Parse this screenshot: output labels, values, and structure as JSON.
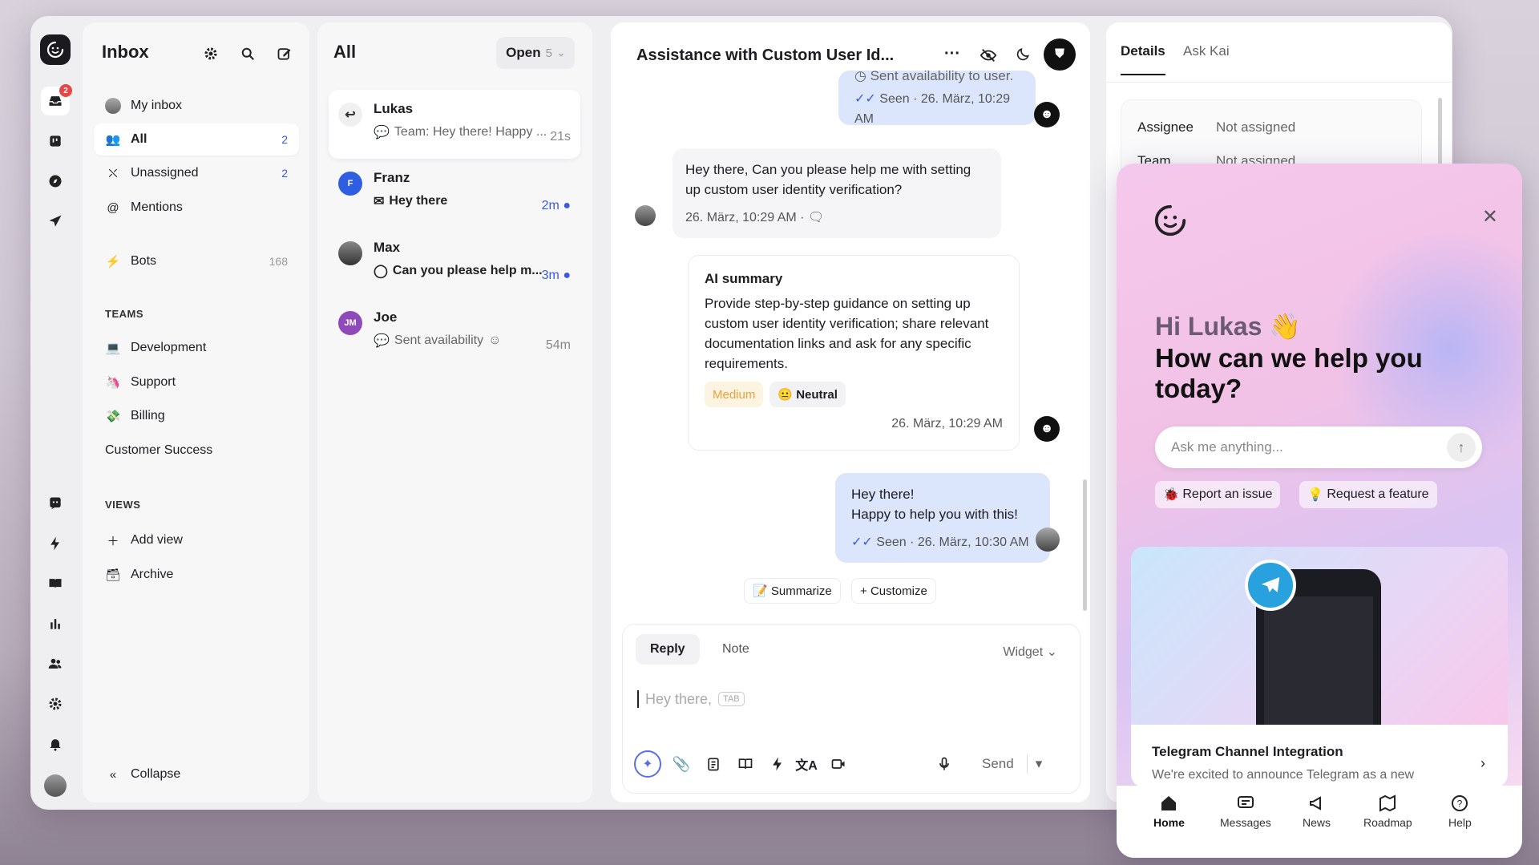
{
  "rail": {
    "badge": "2"
  },
  "sidebar": {
    "title": "Inbox",
    "items": [
      {
        "label": "My inbox",
        "count": ""
      },
      {
        "label": "All",
        "count": "2"
      },
      {
        "label": "Unassigned",
        "count": "2"
      },
      {
        "label": "Mentions",
        "count": ""
      },
      {
        "label": "Bots",
        "count": "168"
      }
    ],
    "teams_heading": "TEAMS",
    "teams": [
      "Development",
      "Support",
      "Billing",
      "Customer Success"
    ],
    "views_heading": "VIEWS",
    "views": [
      "Add view",
      "Archive"
    ],
    "collapse": "Collapse"
  },
  "list": {
    "title": "All",
    "filter": "Open",
    "filter_count": "5",
    "conversations": [
      {
        "name": "Lukas",
        "preview": "Team: Hey there! Happy ...",
        "time": "21s"
      },
      {
        "name": "Franz",
        "avatar": "F",
        "preview": "Hey there",
        "time": "2m"
      },
      {
        "name": "Max",
        "preview": "Can you please help m...",
        "time": "3m"
      },
      {
        "name": "Joe",
        "avatar": "JM",
        "preview": "Sent availability",
        "time": "54m"
      }
    ]
  },
  "chat": {
    "title": "Assistance with Custom User Id...",
    "top_msg_text": "Sent availability to user.",
    "top_msg_meta": "Seen · 26. März, 10:29 AM",
    "incoming": "Hey there, Can you please help me with setting up custom user identity verification?",
    "incoming_meta": "26. März, 10:29 AM ·",
    "ai_title": "AI summary",
    "ai_text": "Provide step-by-step guidance on setting up custom user identity verification; share relevant documentation links and ask for any specific requirements.",
    "ai_priority": "Medium",
    "ai_sentiment": "Neutral",
    "ai_meta": "26. März, 10:29 AM",
    "reply_line1": "Hey there!",
    "reply_line2": "Happy to help you with this!",
    "reply_meta": "Seen · 26. März, 10:30 AM",
    "summarize": "Summarize",
    "customize": "Customize",
    "composer": {
      "tab_reply": "Reply",
      "tab_note": "Note",
      "channel": "Widget",
      "placeholder": "Hey there,",
      "tab_hint": "TAB",
      "send": "Send"
    }
  },
  "details": {
    "tab_details": "Details",
    "tab_ask": "Ask Kai",
    "rows": [
      {
        "label": "Assignee",
        "value": "Not assigned"
      },
      {
        "label": "Team",
        "value": "Not assigned"
      }
    ]
  },
  "widget": {
    "greeting": "Hi Lukas 👋",
    "headline": "How can we help you today?",
    "search_placeholder": "Ask me anything...",
    "report": "Report an issue",
    "request": "Request a feature",
    "news_title": "Telegram Channel Integration",
    "news_text": "We're excited to announce Telegram as a new",
    "nav": [
      "Home",
      "Messages",
      "News",
      "Roadmap",
      "Help"
    ]
  }
}
